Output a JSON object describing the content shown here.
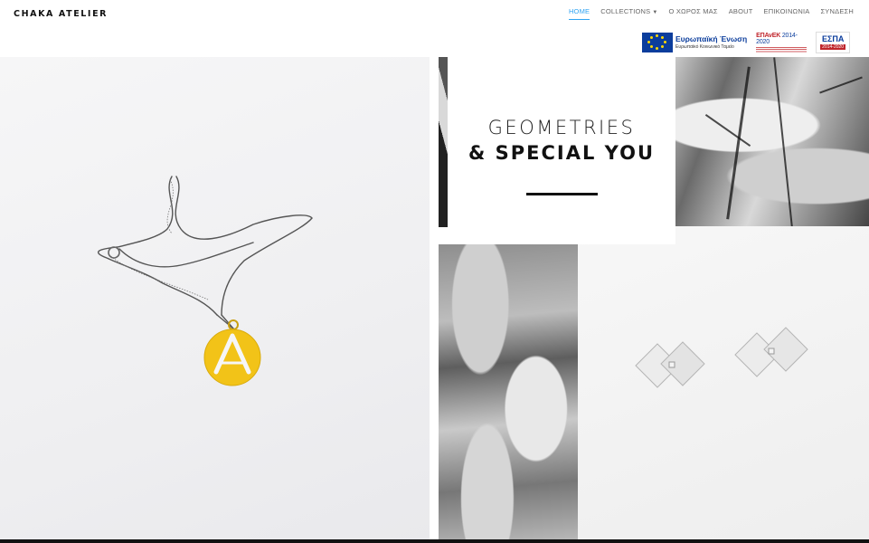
{
  "site": {
    "logo": "CHAKA ATELIER"
  },
  "nav": {
    "items": [
      {
        "label": "HOME",
        "active": true
      },
      {
        "label": "COLLECTIONS",
        "has_dropdown": true
      },
      {
        "label": "Ο ΧΩΡΟΣ ΜΑΣ"
      },
      {
        "label": "ABOUT"
      },
      {
        "label": "ΕΠΙΚΟΙΝΩΝΙΑ"
      },
      {
        "label": "ΣΥΝΔΕΣΗ"
      }
    ],
    "active_color": "#2ea3f2"
  },
  "banner": {
    "eu_title": "Ευρωπαϊκή Ένωση",
    "eu_subtitle": "Ευρωπαϊκό Κοινωνικό Ταμείο",
    "epanek_title": "ΕΠΑνΕΚ",
    "epanek_years": "2014-2020",
    "espa_title": "ΕΣΠΑ",
    "espa_years": "2014-2020"
  },
  "hero": {
    "title_line1": "GEOMETRIES",
    "title_line2": "& SPECIAL YOU"
  },
  "colors": {
    "pendant_gold": "#f2c318",
    "silver": "#e6e6e6",
    "eu_blue": "#0b3d9c",
    "espa_red": "#c0252b"
  }
}
